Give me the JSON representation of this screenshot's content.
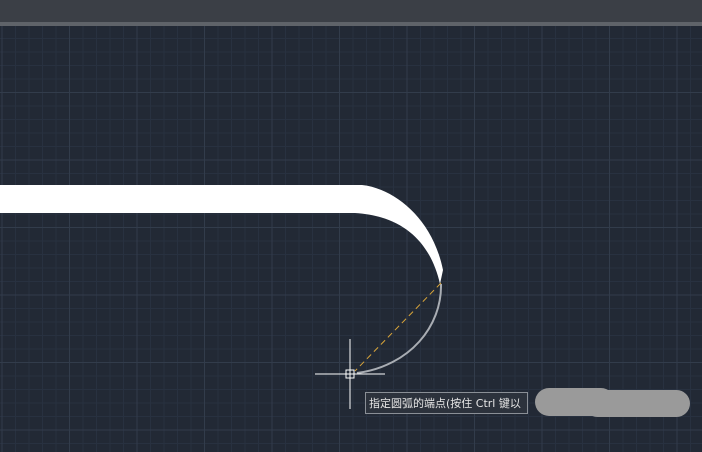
{
  "window": {
    "title_bar": ""
  },
  "drawing": {
    "background_color": "#222935",
    "grid_minor_color": "#283140",
    "grid_major_color": "#323c4b",
    "polyline_color": "#ffffff",
    "preview_arc_color": "#a9adb3",
    "rubberband_color": "#d9a53a",
    "crosshair_color": "#ffffff"
  },
  "tooltip": {
    "prompt": "指定圆弧的端点(按住 Ctrl 键以"
  }
}
